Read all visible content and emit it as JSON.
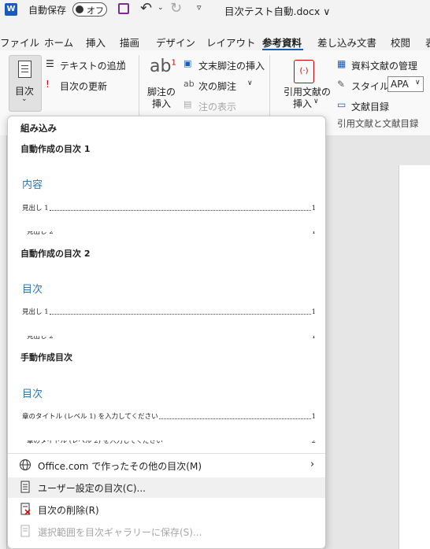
{
  "titlebar": {
    "autosave_label": "自動保存",
    "autosave_state": "オフ",
    "filename": "目次テスト自動.docx ∨"
  },
  "tabs": [
    "ファイル",
    "ホーム",
    "挿入",
    "描画",
    "デザイン",
    "レイアウト",
    "参考資料",
    "差し込み文書",
    "校閲",
    "表"
  ],
  "active_tab": "参考資料",
  "ribbon": {
    "toc_button": "目次",
    "add_text": "テキストの追加",
    "update_toc": "目次の更新",
    "footnote_line1": "脚注の",
    "footnote_line2": "挿入",
    "insert_endnote": "文末脚注の挿入",
    "next_footnote": "次の脚注",
    "show_notes": "注の表示",
    "citation_line1": "引用文献の",
    "citation_line2": "挿入",
    "manage_sources": "資料文献の管理",
    "style_label": "スタイル:",
    "style_value": "APA",
    "bibliography": "文献目録",
    "group_label": "引用文献と文献目録"
  },
  "gallery": {
    "builtin_header": "組み込み",
    "sections": [
      {
        "title": "自動作成の目次 1",
        "heading": "内容",
        "line1": "見出し 1",
        "page1": "1"
      },
      {
        "title": "自動作成の目次 2",
        "heading": "目次",
        "line1": "見出し 1",
        "page1": "1"
      },
      {
        "title": "手動作成目次",
        "heading": "目次",
        "line1": "章のタイトル (レベル 1) を入力してください",
        "page1": "1"
      }
    ],
    "menu": {
      "more_office": "Office.com で作ったその他の目次(M)",
      "custom_toc": "ユーザー設定の目次(C)...",
      "remove_toc": "目次の削除(R)",
      "save_selection": "選択範囲を目次ギャラリーに保存(S)..."
    }
  },
  "colors": {
    "accent": "#185abd",
    "toc_heading": "#2e74b5",
    "word_icon": "#185abd"
  }
}
